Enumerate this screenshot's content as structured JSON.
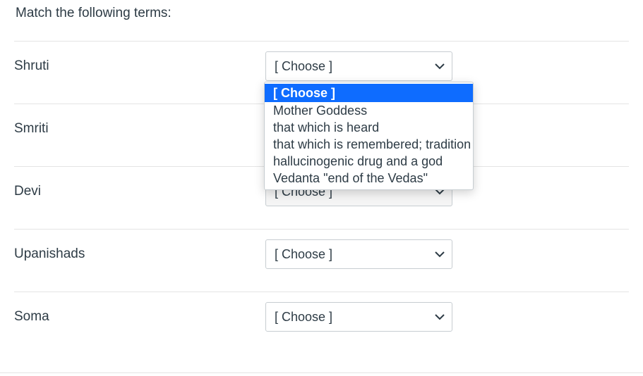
{
  "question": {
    "prompt": "Match the following terms:"
  },
  "placeholder": "[ Choose ]",
  "rows": [
    {
      "term": "Shruti",
      "selected": "[ Choose ]",
      "open": true,
      "underPopup": false
    },
    {
      "term": "Smriti",
      "selected": "[ Choose ]",
      "open": false,
      "underPopup": true
    },
    {
      "term": "Devi",
      "selected": "[ Choose ]",
      "open": false,
      "underPopup": true
    },
    {
      "term": "Upanishads",
      "selected": "[ Choose ]",
      "open": false,
      "underPopup": false
    },
    {
      "term": "Soma",
      "selected": "[ Choose ]",
      "open": false,
      "underPopup": false
    }
  ],
  "dropdown": {
    "options": [
      "[ Choose ]",
      "Mother Goddess",
      "that which is heard",
      "that which is remembered; tradition",
      "hallucinogenic drug and a god",
      "Vedanta \"end of the Vedas\""
    ],
    "highlighted_index": 0
  },
  "icons": {
    "chevron_down": "chevron-down-icon"
  }
}
